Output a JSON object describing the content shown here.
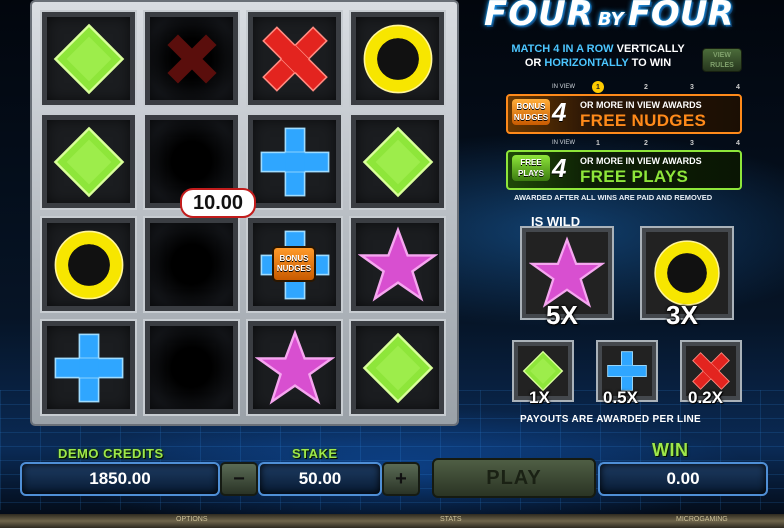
{
  "game": {
    "logo_part1": "FOUR",
    "logo_part2": "BY",
    "logo_part3": "FOUR",
    "match_line1_hl": "MATCH 4 IN A ROW",
    "match_line1_rest": "VERTICALLY",
    "match_line2_pre": "OR",
    "match_line2_hl": "HORIZONTALLY",
    "match_line2_rest": "TO WIN",
    "view_rules": "VIEW RULES"
  },
  "board": {
    "win_amount": "10.00",
    "bonus_tag_line1": "BONUS",
    "bonus_tag_line2": "NUDGES",
    "cells": [
      [
        "diamond",
        "x-dim",
        "x",
        "ring"
      ],
      [
        "diamond",
        "empty",
        "plus",
        "diamond"
      ],
      [
        "ring",
        "empty",
        "plus-bonus",
        "star"
      ],
      [
        "plus",
        "empty",
        "star",
        "diamond"
      ]
    ]
  },
  "awards": {
    "in_view_label": "IN VIEW",
    "dots": [
      "1",
      "2",
      "3",
      "4"
    ],
    "nudges": {
      "icon_line1": "BONUS",
      "icon_line2": "NUDGES",
      "count": "4",
      "small": "OR MORE IN VIEW AWARDS",
      "big": "FREE NUDGES"
    },
    "plays": {
      "icon_line1": "FREE",
      "icon_line2": "PLAYS",
      "count": "4",
      "small": "OR MORE IN VIEW AWARDS",
      "big": "FREE PLAYS"
    },
    "note": "AWARDED AFTER ALL WINS ARE PAID AND REMOVED"
  },
  "paytable": {
    "wild_label": "IS WILD",
    "star_mult": "5X",
    "ring_mult": "3X",
    "diamond_mult": "1X",
    "plus_mult": "0.5X",
    "x_mult": "0.2X",
    "per_line": "PAYOUTS ARE AWARDED PER LINE"
  },
  "controls": {
    "credits_label": "DEMO CREDITS",
    "credits_value": "1850.00",
    "stake_label": "STAKE",
    "stake_value": "50.00",
    "minus": "−",
    "plus": "+",
    "play": "PLAY",
    "win_label": "WIN",
    "win_value": "0.00"
  },
  "statusbar": {
    "options": "OPTIONS",
    "stats": "STATS",
    "brand": "MICROGAMING"
  },
  "colors": {
    "green": "#8ee63a",
    "blue": "#2fa6ff",
    "red": "#e3241f",
    "yellow": "#f7e600",
    "pink": "#d84fd0",
    "orange": "#ff8a1a"
  }
}
